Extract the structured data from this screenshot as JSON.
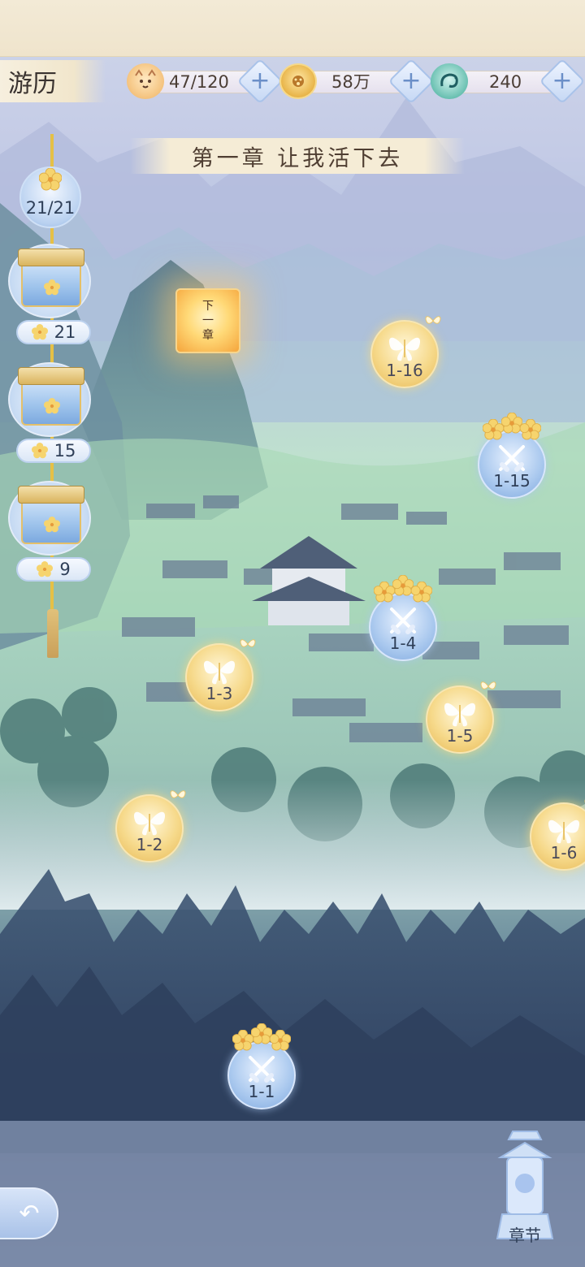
{
  "header": {
    "title": "游历",
    "resources": [
      {
        "icon": "cat-face-icon",
        "value": "47/120"
      },
      {
        "icon": "coin-icon",
        "value": "58万"
      },
      {
        "icon": "serpent-icon",
        "value": "240"
      }
    ]
  },
  "chapter": {
    "banner": "第一章 让我活下去",
    "next_lantern": "下一章"
  },
  "progress": {
    "total": "21/21",
    "milestones": [
      "21",
      "15",
      "9"
    ]
  },
  "stages": [
    {
      "id": "1-1",
      "type": "battle"
    },
    {
      "id": "1-2",
      "type": "story"
    },
    {
      "id": "1-3",
      "type": "story"
    },
    {
      "id": "1-4",
      "type": "battle"
    },
    {
      "id": "1-5",
      "type": "story"
    },
    {
      "id": "1-6",
      "type": "story"
    },
    {
      "id": "1-15",
      "type": "battle"
    },
    {
      "id": "1-16",
      "type": "story"
    }
  ],
  "footer": {
    "back_icon": "back-arrow-icon",
    "chapter_button": "章节"
  }
}
